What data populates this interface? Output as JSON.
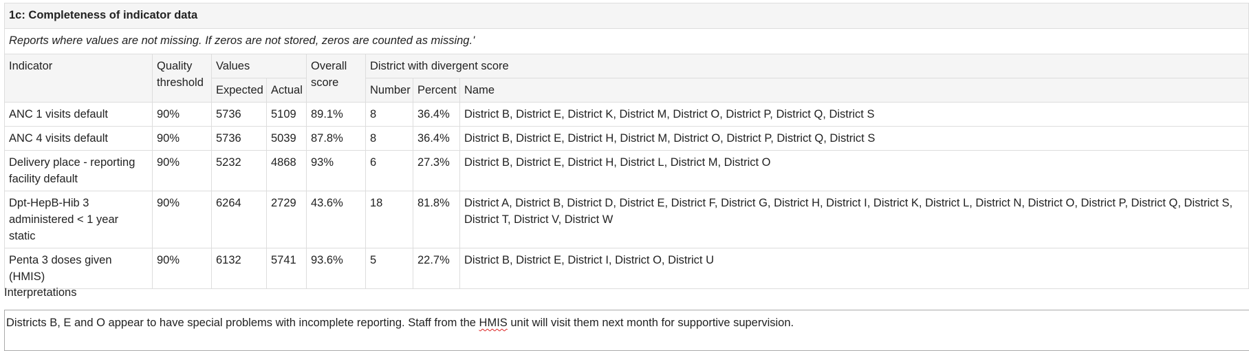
{
  "section": {
    "title": "1c: Completeness of indicator data",
    "subtitle": "Reports where values are not missing. If zeros are not stored, zeros are counted as missing.'"
  },
  "headers": {
    "indicator": "Indicator",
    "quality_threshold": "Quality threshold",
    "values": "Values",
    "expected": "Expected",
    "actual": "Actual",
    "overall_score": "Overall score",
    "divergent": "District with divergent score",
    "number": "Number",
    "percent": "Percent",
    "name": "Name"
  },
  "rows": [
    {
      "indicator": "ANC 1 visits default",
      "threshold": "90%",
      "expected": "5736",
      "actual": "5109",
      "score": "89.1%",
      "number": "8",
      "percent": "36.4%",
      "names": "District B, District E, District K, District M, District O, District P, District Q, District S"
    },
    {
      "indicator": "ANC 4 visits default",
      "threshold": "90%",
      "expected": "5736",
      "actual": "5039",
      "score": "87.8%",
      "number": "8",
      "percent": "36.4%",
      "names": "District B, District E, District H, District M, District O, District P, District Q, District S"
    },
    {
      "indicator": "Delivery place - reporting facility default",
      "threshold": "90%",
      "expected": "5232",
      "actual": "4868",
      "score": "93%",
      "number": "6",
      "percent": "27.3%",
      "names": "District B, District E, District H, District L, District M, District O"
    },
    {
      "indicator": "Dpt-HepB-Hib 3 administered < 1 year static",
      "threshold": "90%",
      "expected": "6264",
      "actual": "2729",
      "score": "43.6%",
      "number": "18",
      "percent": "81.8%",
      "names": "District A, District B, District D, District E, District F, District G, District H, District I, District K, District L, District N, District O, District P, District Q, District S, District T, District V, District W"
    },
    {
      "indicator": "Penta 3 doses given (HMIS)",
      "threshold": "90%",
      "expected": "6132",
      "actual": "5741",
      "score": "93.6%",
      "number": "5",
      "percent": "22.7%",
      "names": "District B, District E, District I, District O, District U"
    }
  ],
  "interpretations": {
    "label": "Interpretations",
    "text_before": "Districts B, E and O appear to have special problems with incomplete reporting.  Staff from the ",
    "text_flagged": "HMIS",
    "text_after": " unit will visit them next month for supportive supervision."
  }
}
